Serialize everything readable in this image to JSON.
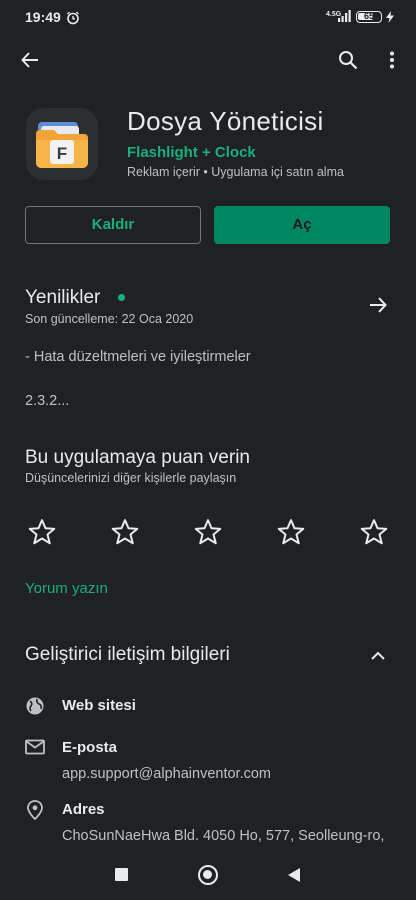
{
  "status_bar": {
    "time": "19:49",
    "network": "4.5G",
    "battery": "65"
  },
  "app": {
    "title": "Dosya Yöneticisi",
    "developer": "Flashlight + Clock",
    "meta": "Reklam içerir  •  Uygulama içi satın alma",
    "icon_letter": "F"
  },
  "actions": {
    "uninstall_label": "Kaldır",
    "open_label": "Aç"
  },
  "whats_new": {
    "title": "Yenilikler",
    "updated": "Son güncelleme: 22 Oca 2020",
    "line1": "- Hata düzeltmeleri ve iyileştirmeler",
    "line2": "2.3.2..."
  },
  "rate": {
    "title": "Bu uygulamaya puan verin",
    "subtitle": "Düşüncelerinizi diğer kişilerle paylaşın",
    "stars": 5,
    "write_review": "Yorum yazın"
  },
  "developer_contact": {
    "title": "Geliştirici iletişim bilgileri",
    "website_label": "Web sitesi",
    "email_label": "E-posta",
    "email_value": "app.support@alphainventor.com",
    "address_label": "Adres",
    "address_value": "ChoSunNaeHwa Bld. 4050 Ho, 577, Seolleung-ro,"
  },
  "colors": {
    "background": "#202124",
    "accent": "#01875f",
    "accent_text": "#19b07a"
  }
}
